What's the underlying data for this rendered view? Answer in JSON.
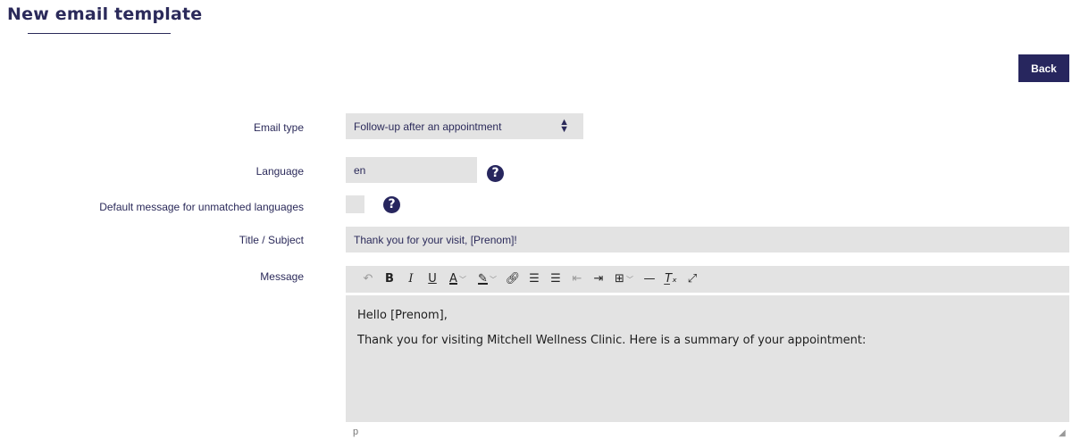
{
  "page": {
    "title": "New email template",
    "back_label": "Back"
  },
  "form": {
    "email_type": {
      "label": "Email type",
      "value": "Follow-up after an appointment"
    },
    "language": {
      "label": "Language",
      "value": "en"
    },
    "default_message": {
      "label": "Default message for unmatched languages",
      "checked": false
    },
    "subject": {
      "label": "Title / Subject",
      "value": "Thank you for your visit, [Prenom]!"
    },
    "message": {
      "label": "Message",
      "paragraphs": [
        "Hello [Prenom],",
        "Thank you for visiting Mitchell Wellness Clinic. Here is a summary of your appointment:"
      ],
      "status_path": "p"
    }
  },
  "toolbar": {
    "buttons": [
      "undo-icon",
      "bold-icon",
      "italic-icon",
      "underline-icon",
      "text-color-icon",
      "highlight-icon",
      "link-icon",
      "numbered-list-icon",
      "bulleted-list-icon",
      "outdent-icon",
      "indent-icon",
      "table-icon",
      "horizontal-rule-icon",
      "clear-formatting-icon",
      "fullscreen-icon"
    ]
  },
  "colors": {
    "brand": "#27265e",
    "field_bg": "#e3e3e3",
    "text": "#2b2a5a"
  }
}
